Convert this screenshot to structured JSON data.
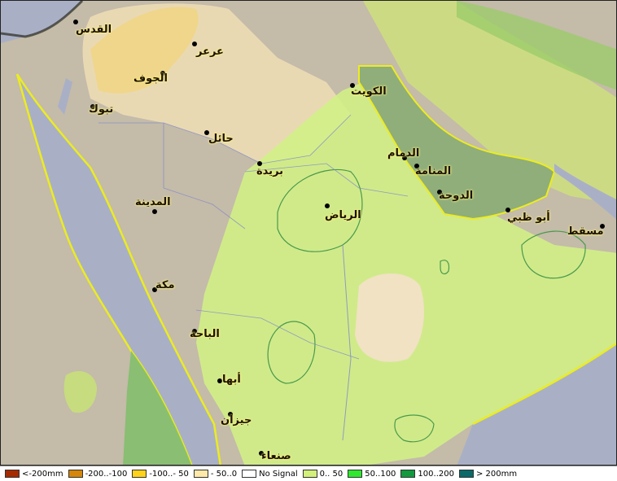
{
  "cities": [
    {
      "key": "quds",
      "name": "القدس"
    },
    {
      "key": "arar",
      "name": "عرعر"
    },
    {
      "key": "jawf",
      "name": "الجوف"
    },
    {
      "key": "tabuk",
      "name": "تبوك"
    },
    {
      "key": "hail",
      "name": "حائل"
    },
    {
      "key": "kuwait",
      "name": "الكويت"
    },
    {
      "key": "buraydah",
      "name": "بريدة"
    },
    {
      "key": "dammam",
      "name": "الدمام"
    },
    {
      "key": "manama",
      "name": "المنامة"
    },
    {
      "key": "doha",
      "name": "الدوحة"
    },
    {
      "key": "riyadh",
      "name": "الرياض"
    },
    {
      "key": "madinah",
      "name": "المدينة"
    },
    {
      "key": "abudhabi",
      "name": "أبو ظبي"
    },
    {
      "key": "muscat",
      "name": "مسقط"
    },
    {
      "key": "makkah",
      "name": "مكة"
    },
    {
      "key": "baha",
      "name": "الباحة"
    },
    {
      "key": "abha",
      "name": "أبها"
    },
    {
      "key": "jizan",
      "name": "جيزان"
    },
    {
      "key": "sanaa",
      "name": "صنعاء"
    }
  ],
  "legend": [
    {
      "label": "<-200mm",
      "color": "#a52a00"
    },
    {
      "label": "-200..-100",
      "color": "#d4870a"
    },
    {
      "label": "-100..- 50",
      "color": "#ffd21a"
    },
    {
      "label": "- 50..0",
      "color": "#ffe9a8"
    },
    {
      "label": "No Signal",
      "color": "#ffffff"
    },
    {
      "label": "0.. 50",
      "color": "#d2f07a"
    },
    {
      "label": "50..100",
      "color": "#2ee82e"
    },
    {
      "label": "100..200",
      "color": "#129a3e"
    },
    {
      "label": "> 200mm",
      "color": "#0a6a6a"
    }
  ]
}
